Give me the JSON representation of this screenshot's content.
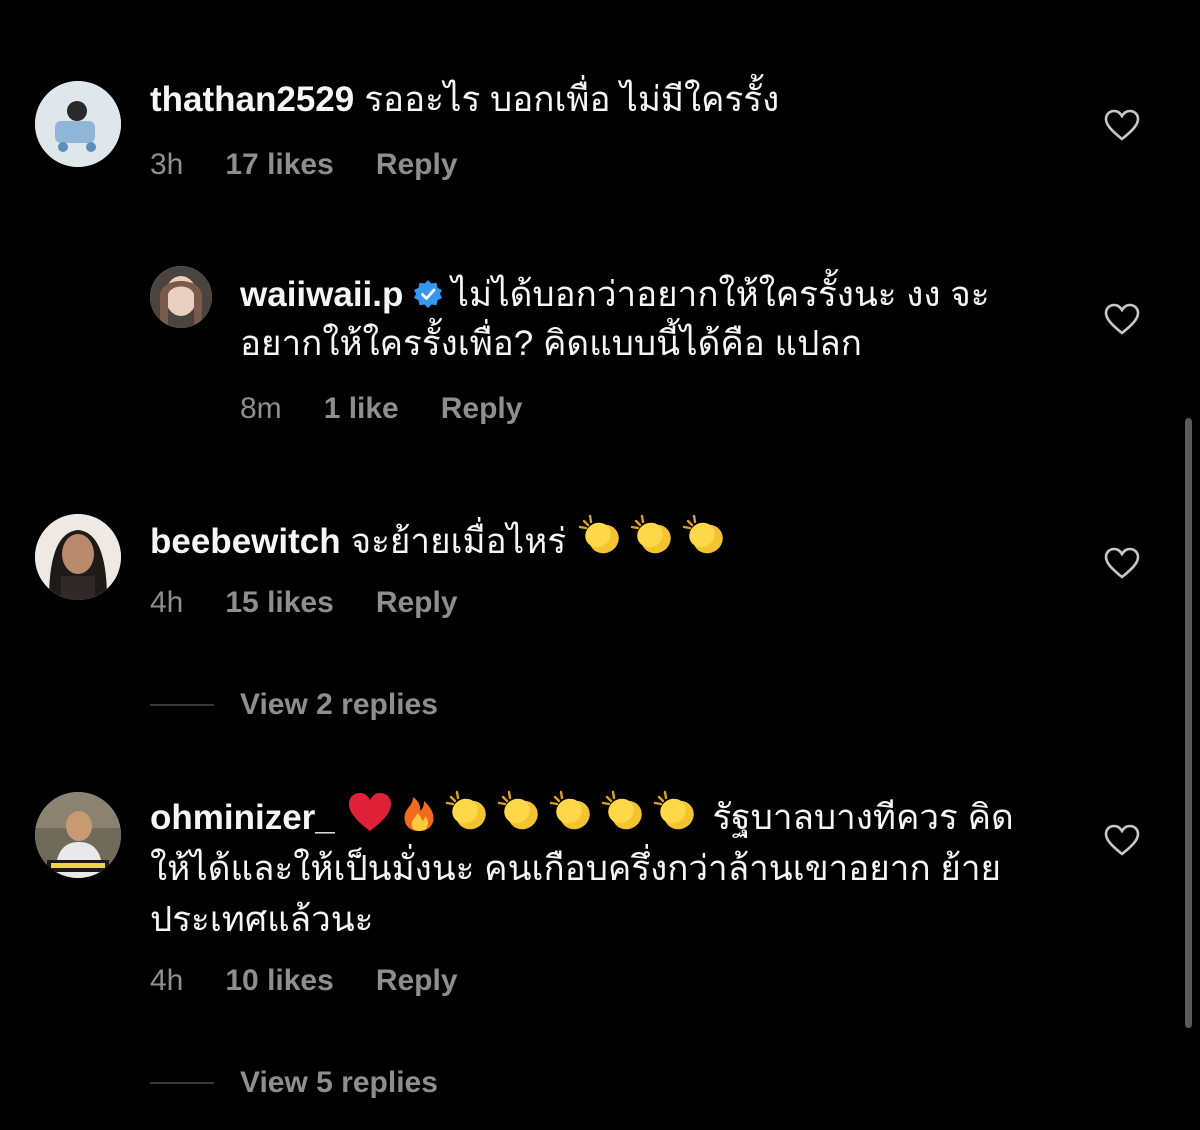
{
  "comments": [
    {
      "username": "thathan2529",
      "text": "รออะไร บอกเพื่อ ไม่มีใครรั้ง",
      "time": "3h",
      "likes": "17 likes",
      "reply": "Reply"
    },
    {
      "username": "waiiwaii.p",
      "verified": true,
      "text": "ไม่ได้บอกว่าอยากให้ใครรั้งนะ งง จะอยากให้ใครรั้งเพื่อ? คิดแบบนี้ได้คือ แปลก",
      "time": "8m",
      "likes": "1 like",
      "reply": "Reply"
    },
    {
      "username": "beebewitch",
      "text": "จะย้ายเมื่อไหร่",
      "emojis": [
        "clapping-hands",
        "clapping-hands",
        "clapping-hands"
      ],
      "time": "4h",
      "likes": "15 likes",
      "reply": "Reply",
      "view_replies": "View 2 replies"
    },
    {
      "username": "ohminizer_",
      "emojis": [
        "red-heart",
        "fire",
        "clapping-hands",
        "clapping-hands",
        "clapping-hands",
        "clapping-hands",
        "clapping-hands"
      ],
      "text_line1": "รัฐบาลบางทีควร",
      "text_rest": "คิดให้ได้และให้เป็นมั่งนะ คนเกือบครึ่งกว่าล้านเขาอยาก ย้ายประเทศแล้วนะ",
      "time": "4h",
      "likes": "10 likes",
      "reply": "Reply",
      "view_replies": "View 5 replies"
    }
  ],
  "colors": {
    "background": "#000000",
    "text": "#f5f5f5",
    "meta": "#8e8e8e",
    "verified": "#3897f0"
  }
}
